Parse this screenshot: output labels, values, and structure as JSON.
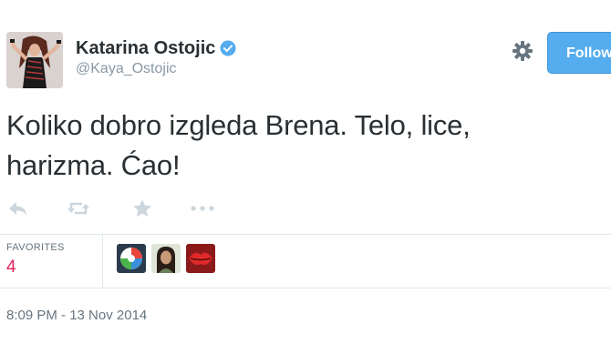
{
  "author": {
    "fullname": "Katarina Ostojic",
    "screen_name": "@Kaya_Ostojic",
    "verified": true,
    "verified_color": "#55acee"
  },
  "header": {
    "settings_icon": "gear-icon",
    "follow_label": "Follow"
  },
  "tweet": {
    "text_line1": "Koliko dobro izgleda Brena. Telo, lice,",
    "text_line2": "harizma. Ćao!"
  },
  "actions": {
    "icons": [
      "reply-icon",
      "retweet-icon",
      "favorite-star-icon",
      "more-icon"
    ]
  },
  "stats": {
    "favorites_label": "FAVORITES",
    "favorites_count": "4",
    "favorites_color": "#e0245e"
  },
  "favorited_by_avatars": [
    "favoriter-avatar-1",
    "favoriter-avatar-2",
    "favoriter-avatar-3"
  ],
  "timestamp": "8:09 PM - 13 Nov 2014",
  "colors": {
    "accent": "#55acee",
    "text": "#292f33",
    "muted": "#8899a6",
    "border": "#e1e8ed"
  }
}
